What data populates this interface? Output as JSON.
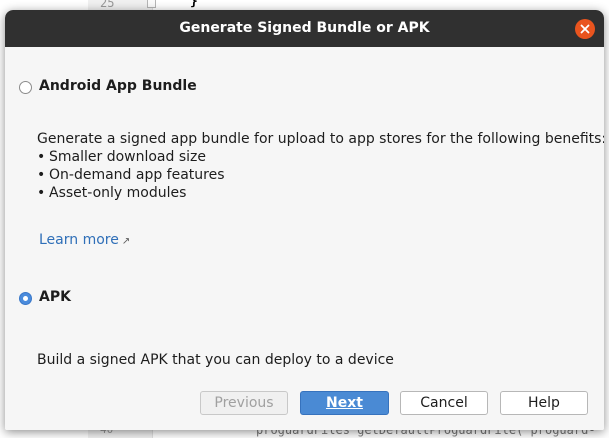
{
  "background_editor": {
    "line_number_top": "25",
    "brace": "}",
    "line_number_bottom": "40",
    "bottom_code": "proguardFiles getDefaultProguardFile('proguard-"
  },
  "dialog": {
    "title": "Generate Signed Bundle or APK",
    "close_icon": "close-icon",
    "options": [
      {
        "label": "Android App Bundle",
        "selected": false,
        "description": "Generate a signed app bundle for upload to app stores for the following benefits:",
        "bullets": [
          "Smaller download size",
          "On-demand app features",
          "Asset-only modules"
        ],
        "link_label": "Learn more",
        "link_icon": "external-link-icon"
      },
      {
        "label": "APK",
        "selected": true,
        "description": "Build a signed APK that you can deploy to a device"
      }
    ],
    "buttons": {
      "previous": "Previous",
      "next": "Next",
      "cancel": "Cancel",
      "help": "Help"
    }
  },
  "colors": {
    "titlebar": "#303030",
    "close": "#e9541e",
    "accent": "#4a8ad4",
    "link": "#2f6fb8"
  }
}
